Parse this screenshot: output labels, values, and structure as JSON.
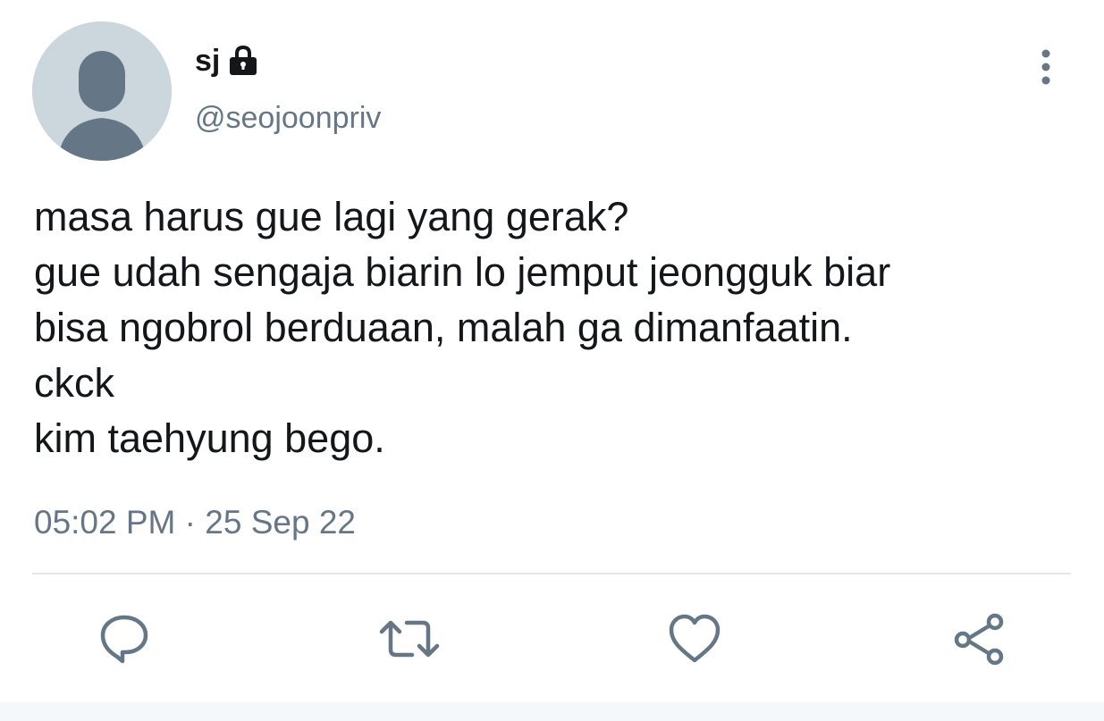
{
  "user": {
    "display_name": "sj",
    "handle": "@seojoonpriv",
    "protected_icon": "lock-icon",
    "avatar_icon": "default-avatar-icon"
  },
  "tweet": {
    "lines": [
      "masa harus gue lagi yang gerak?",
      "gue udah sengaja biarin lo jemput jeongguk biar",
      "bisa ngobrol berduaan, malah ga dimanfaatin.",
      "ckck",
      "kim taehyung bego."
    ],
    "time": "05:02 PM",
    "separator": "·",
    "date": "25 Sep 22"
  },
  "actions": {
    "reply_icon": "reply-icon",
    "retweet_icon": "retweet-icon",
    "like_icon": "heart-icon",
    "share_icon": "share-icon",
    "more_icon": "more-vertical-icon"
  },
  "colors": {
    "text": "#14171a",
    "secondary": "#657786",
    "avatar_bg": "#ccd6dd",
    "avatar_figure": "#657786",
    "divider": "#e1e8ed"
  }
}
